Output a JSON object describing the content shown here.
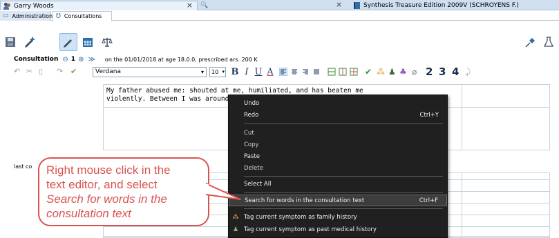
{
  "doc_tabs": [
    {
      "title": "Garry Woods",
      "close": "×"
    },
    {
      "title": "Synthesis Treasure Edition 2009V (SCHROYENS F.)",
      "close": "×"
    }
  ],
  "search_tab_icon": "🔍",
  "sub_tabs": [
    {
      "label": "Administration",
      "icon": "administration-icon"
    },
    {
      "label": "Consultations",
      "icon": "stethoscope-icon"
    }
  ],
  "main_toolbar": {
    "icons": [
      "save-icon",
      "add-edit-icon",
      "edit-icon",
      "calendar-icon",
      "balance-icon",
      "pin-icon",
      "flask-icon"
    ]
  },
  "consultation": {
    "label": "Consultation",
    "prev": "⊖",
    "number": "1",
    "next": "⊕",
    "expand": "≫",
    "info": "on the 01/01/2018 at age 18.0.0, prescribed ars. 200 K"
  },
  "format_toolbar": {
    "font": "Verdana",
    "size": "10",
    "bold": "B",
    "italic": "I",
    "underline": "U",
    "color": "A",
    "heading_numbers": [
      "2",
      "3",
      "4"
    ]
  },
  "editor": {
    "line1": "My father abused me: shouted at me, humiliated, and has beaten me",
    "line2": "violently. Between I was around 1"
  },
  "second_section_label": "last co",
  "context_menu": {
    "items": [
      {
        "label": "Undo",
        "shortcut": ""
      },
      {
        "label": "Redo",
        "shortcut": "Ctrl+Y"
      },
      {
        "label": "Cut",
        "shortcut": ""
      },
      {
        "label": "Copy",
        "shortcut": ""
      },
      {
        "label": "Paste",
        "shortcut": ""
      },
      {
        "label": "Delete",
        "shortcut": ""
      },
      {
        "label": "Select All",
        "shortcut": ""
      },
      {
        "label": "Search for words in the consultation text",
        "shortcut": "Ctrl+F"
      },
      {
        "label": "Tag current symptom as family history",
        "shortcut": ""
      },
      {
        "label": "Tag current symptom as past medical history",
        "shortcut": ""
      }
    ]
  },
  "callout": {
    "line1": "Right mouse click in the",
    "line2": "text editor, and select",
    "line3": "Search for words in the",
    "line4": "consultation text"
  },
  "colors": {
    "callout": "#d9534f",
    "menu_bg": "#202020",
    "tab_bg": "#cfdff0"
  }
}
